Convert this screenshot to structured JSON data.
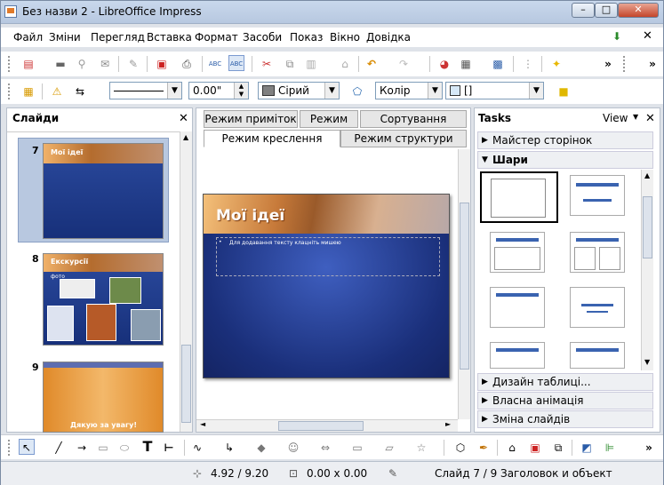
{
  "window": {
    "title": "Без назви 2 - LibreOffice Impress"
  },
  "menu": [
    "Файл",
    "Зміни",
    "Перегляд",
    "Вставка",
    "Формат",
    "Засоби",
    "Показ",
    "Вікно",
    "Довідка"
  ],
  "lineprops": {
    "width": "0.00\"",
    "area_color": "Сірий",
    "area_style": "Колір",
    "area_fill": "[]"
  },
  "slides_pane": {
    "title": "Слайди",
    "slides": [
      {
        "num": "7",
        "title": "Мої ідеї"
      },
      {
        "num": "8",
        "title": "Екскурсії",
        "bullet": "фото"
      },
      {
        "num": "9",
        "title": "Дякую за увагу!"
      }
    ]
  },
  "tabs": {
    "row1": [
      "Режим приміток",
      "Режим тез",
      "Сортування слайду"
    ],
    "row2": [
      "Режим креслення",
      "Режим структури"
    ]
  },
  "slide": {
    "title": "Мої ідеї",
    "placeholder": "Для додавання тексту клацніть мишею"
  },
  "tasks": {
    "title": "Tasks",
    "view": "View",
    "sections": [
      "Майстер сторінок",
      "Шари",
      "Дизайн таблиці...",
      "Власна анімація",
      "Зміна слайдів"
    ]
  },
  "status": {
    "position": "4.92 / 9.20",
    "size": "0.00 x 0.00",
    "slide": "Слайд 7 / 9",
    "layout": "Заголовок и объект"
  }
}
